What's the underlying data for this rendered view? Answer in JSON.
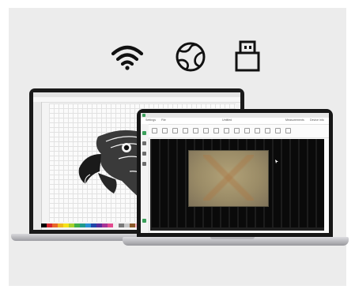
{
  "icons": [
    "wifi-icon",
    "globe-icon",
    "usb-icon"
  ],
  "colors": {
    "background": "#ececec",
    "laptop_bezel": "#1a1a1a",
    "laptop_silver": "#b8b8bd",
    "camera_view": "#0a0a0a",
    "material": "#a3936c",
    "app_accent": "#3aa05a"
  },
  "back_laptop": {
    "content": "eagle-head-vector-artwork",
    "palette": [
      "#000000",
      "#d6262f",
      "#e8672a",
      "#f0b820",
      "#f6e21a",
      "#a8d02c",
      "#3fae49",
      "#1f9a8a",
      "#2a8fd6",
      "#2046a8",
      "#5b2c9c",
      "#a63596",
      "#e34a8f",
      "#f0f0f0",
      "#7a7a7a",
      "#c8c8c8",
      "#8b5a2b",
      "#ffb6c1",
      "#00bcd4",
      "#ff9800",
      "#009688",
      "#673ab7",
      "#cddc39",
      "#795548",
      "#607d8b",
      "#e91e63",
      "#9c27b0",
      "#3f51b5",
      "#03a9f4",
      "#8bc34a",
      "#ffeb3b",
      "#ff5722",
      "#9e9e9e",
      "#000080",
      "#808000",
      "#008080"
    ]
  },
  "front_laptop": {
    "menu": {
      "settings": "Settings",
      "file": "File",
      "center_title": "Untitled",
      "right_1": "Measurements",
      "right_2": "Device info"
    },
    "camera_overlay": "material-on-bed"
  }
}
